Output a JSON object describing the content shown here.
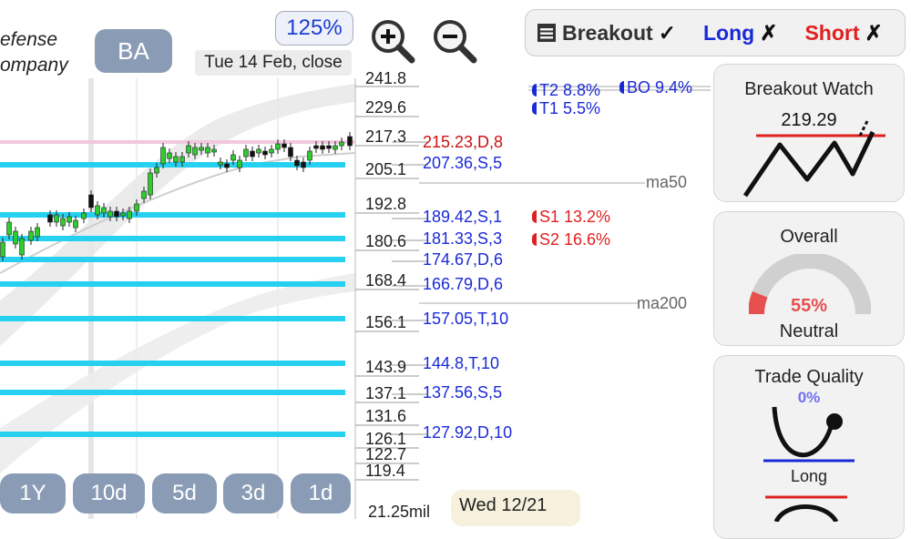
{
  "header": {
    "company_line1": "efense",
    "company_line2": "ompany",
    "ticker": "BA",
    "zoom_level": "125%",
    "date_label": "Tue 14 Feb, close"
  },
  "tabs": [
    {
      "label": "Breakout",
      "mark": "✓",
      "color": "#333333"
    },
    {
      "label": "Long",
      "mark": "✗",
      "color": "#1a2ad8"
    },
    {
      "label": "Short",
      "mark": "✗",
      "color": "#e02020"
    }
  ],
  "price_axis": [
    "241.8",
    "229.6",
    "217.3",
    "205.1",
    "192.8",
    "180.6",
    "168.4",
    "156.1",
    "143.9",
    "137.1",
    "131.6",
    "126.1",
    "122.7",
    "119.4"
  ],
  "volume_label": "21.25mil",
  "levels": [
    {
      "text": "215.23,D,8",
      "color": "#cc1111"
    },
    {
      "text": "207.36,S,5",
      "color": "#1a2ad8"
    },
    {
      "text": "189.42,S,1",
      "color": "#1a2ad8"
    },
    {
      "text": "181.33,S,3",
      "color": "#1a2ad8"
    },
    {
      "text": "174.67,D,6",
      "color": "#1a2ad8"
    },
    {
      "text": "166.79,D,6",
      "color": "#1a2ad8"
    },
    {
      "text": "157.05,T,10",
      "color": "#1a2ad8"
    },
    {
      "text": "144.8,T,10",
      "color": "#1a2ad8"
    },
    {
      "text": "137.56,S,5",
      "color": "#1a2ad8"
    },
    {
      "text": "127.92,D,10",
      "color": "#1a2ad8"
    }
  ],
  "targets": [
    {
      "text": "T2 8.8%",
      "color": "#1a2ad8"
    },
    {
      "text": "BO 9.4%",
      "color": "#1a2ad8"
    },
    {
      "text": "T1 5.5%",
      "color": "#1a2ad8"
    },
    {
      "text": "S1 13.2%",
      "color": "#e02020"
    },
    {
      "text": "S2 16.6%",
      "color": "#e02020"
    }
  ],
  "ma_labels": [
    "ma50",
    "ma200"
  ],
  "breakout_watch": {
    "title": "Breakout Watch",
    "price": "219.29"
  },
  "overall": {
    "title": "Overall",
    "value": "55%",
    "verdict": "Neutral",
    "fill_fraction": 0.55
  },
  "trade_quality": {
    "title": "Trade Quality",
    "value": "0%",
    "label": "Long"
  },
  "periods": [
    "1Y",
    "10d",
    "5d",
    "3d",
    "1d"
  ],
  "date_tip": "Wed 12/21"
}
